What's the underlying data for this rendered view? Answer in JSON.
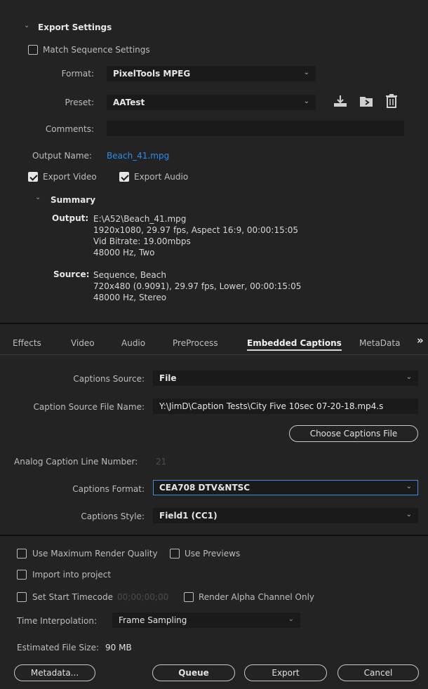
{
  "export_settings": {
    "section_title": "Export Settings",
    "match_sequence_label": "Match Sequence Settings",
    "format_label": "Format:",
    "format_value": "PixelTools MPEG",
    "preset_label": "Preset:",
    "preset_value": "AATest",
    "comments_label": "Comments:",
    "comments_value": "",
    "output_name_label": "Output Name:",
    "output_name_value": "Beach_41.mpg",
    "export_video_label": "Export Video",
    "export_audio_label": "Export Audio",
    "icons": [
      "save-preset-icon",
      "import-preset-icon",
      "delete-preset-icon"
    ]
  },
  "summary": {
    "title": "Summary",
    "output_label": "Output:",
    "output_lines": [
      "E:\\A52\\Beach_41.mpg",
      "1920x1080, 29.97 fps, Aspect 16:9, 00:00:15:05",
      "Vid Bitrate: 19.00mbps",
      "48000 Hz, Two"
    ],
    "source_label": "Source:",
    "source_lines": [
      "Sequence, Beach",
      "720x480 (0.9091), 29.97 fps, Lower, 00:00:15:05",
      "48000 Hz, Stereo"
    ]
  },
  "tabs": {
    "items": [
      "Effects",
      "Video",
      "Audio",
      "PreProcess",
      "Embedded Captions",
      "MetaData"
    ],
    "active": "Embedded Captions",
    "overflow": "»"
  },
  "captions": {
    "source_label": "Captions Source:",
    "source_value": "File",
    "file_name_label": "Caption Source File Name:",
    "file_name_value": "Y:\\JimD\\Caption Tests\\City Five  10sec 07-20-18.mp4.s",
    "choose_button": "Choose Captions File",
    "line_number_label": "Analog Caption Line Number:",
    "line_number_value": "21",
    "format_label": "Captions Format:",
    "format_value": "CEA708 DTV&NTSC",
    "style_label": "Captions Style:",
    "style_value": "Field1 (CC1)"
  },
  "bottom": {
    "max_render_label": "Use Maximum Render Quality",
    "use_previews_label": "Use Previews",
    "import_label": "Import into project",
    "start_tc_label": "Set Start Timecode",
    "start_tc_value": "00;00;00;00",
    "render_alpha_label": "Render Alpha Channel Only",
    "time_interp_label": "Time Interpolation:",
    "time_interp_value": "Frame Sampling",
    "file_size_label": "Estimated File Size:",
    "file_size_value": "90 MB",
    "metadata_button": "Metadata...",
    "queue_button": "Queue",
    "export_button": "Export",
    "cancel_button": "Cancel"
  },
  "colors": {
    "accent": "#2d8ceb",
    "focus_border": "#3c8ce6",
    "panel": "#232323",
    "field": "#1a1a1a"
  }
}
